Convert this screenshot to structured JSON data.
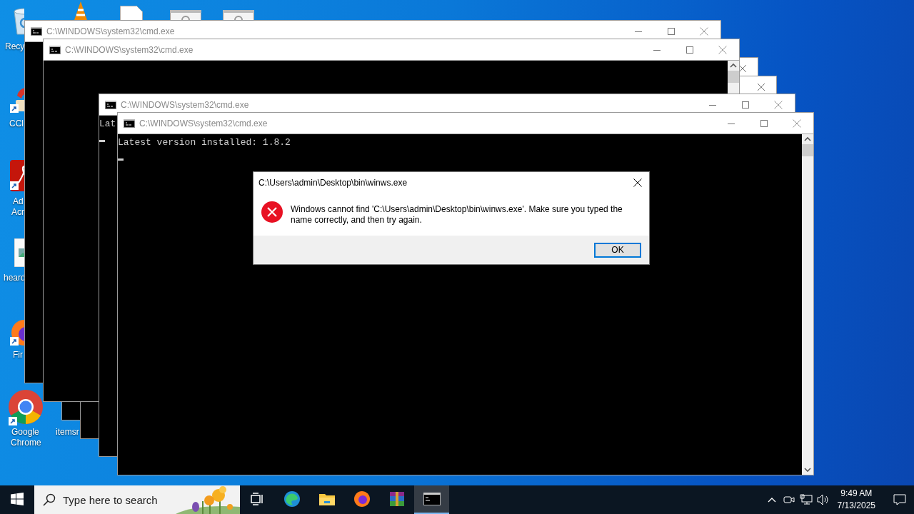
{
  "desktop_icons": [
    {
      "kind": "recycle-bin",
      "label_lines": [
        "Recy"
      ]
    },
    {
      "kind": "cleaner",
      "label_lines": [
        "CCl"
      ],
      "shortcut": true
    },
    {
      "kind": "pdf-app",
      "label_lines": [
        "Ad",
        "Acr"
      ],
      "shortcut": true
    },
    {
      "kind": "image-file",
      "label_lines": [
        "heard"
      ]
    },
    {
      "kind": "fox-browser",
      "label_lines": [
        "Fir"
      ],
      "shortcut": true
    },
    {
      "kind": "round-browser",
      "label_lines": [
        "Google",
        "Chrome"
      ],
      "shortcut": true
    },
    {
      "kind": "none",
      "label_lines": [
        "itemsr"
      ]
    },
    {
      "kind": "cone"
    },
    {
      "kind": "document"
    },
    {
      "kind": "app-window"
    },
    {
      "kind": "app-window"
    }
  ],
  "windows": [
    {
      "kind": "titled",
      "title": "C:\\WINDOWS\\system32\\cmd.exe"
    },
    {
      "kind": "titled",
      "title": "C:\\WINDOWS\\system32\\cmd.exe",
      "scrollbar": true
    },
    {
      "kind": "edge"
    },
    {
      "kind": "edge"
    },
    {
      "kind": "titled",
      "title": "C:\\WINDOWS\\system32\\cmd.exe",
      "lines": [
        "Lat"
      ],
      "cursor": true
    },
    {
      "kind": "titled",
      "title": "C:\\WINDOWS\\system32\\cmd.exe",
      "lines": [
        "Latest version installed: 1.8.2"
      ],
      "cursor": true,
      "scrollbar": true
    }
  ],
  "dialog": {
    "title": "C:\\Users\\admin\\Desktop\\bin\\winws.exe",
    "kind": "error",
    "message": "Windows cannot find 'C:\\Users\\admin\\Desktop\\bin\\winws.exe'. Make sure you typed the name correctly, and then try again.",
    "button": "OK"
  },
  "taskbar": {
    "search_placeholder": "Type here to search",
    "apps": [
      {
        "kind": "task-view",
        "selected": false
      },
      {
        "kind": "edge",
        "selected": false
      },
      {
        "kind": "folder",
        "selected": false
      },
      {
        "kind": "firefox",
        "selected": false
      },
      {
        "kind": "archive",
        "selected": false
      },
      {
        "kind": "terminal",
        "selected": true
      }
    ],
    "time": "9:49 AM",
    "date": "7/13/2025"
  }
}
